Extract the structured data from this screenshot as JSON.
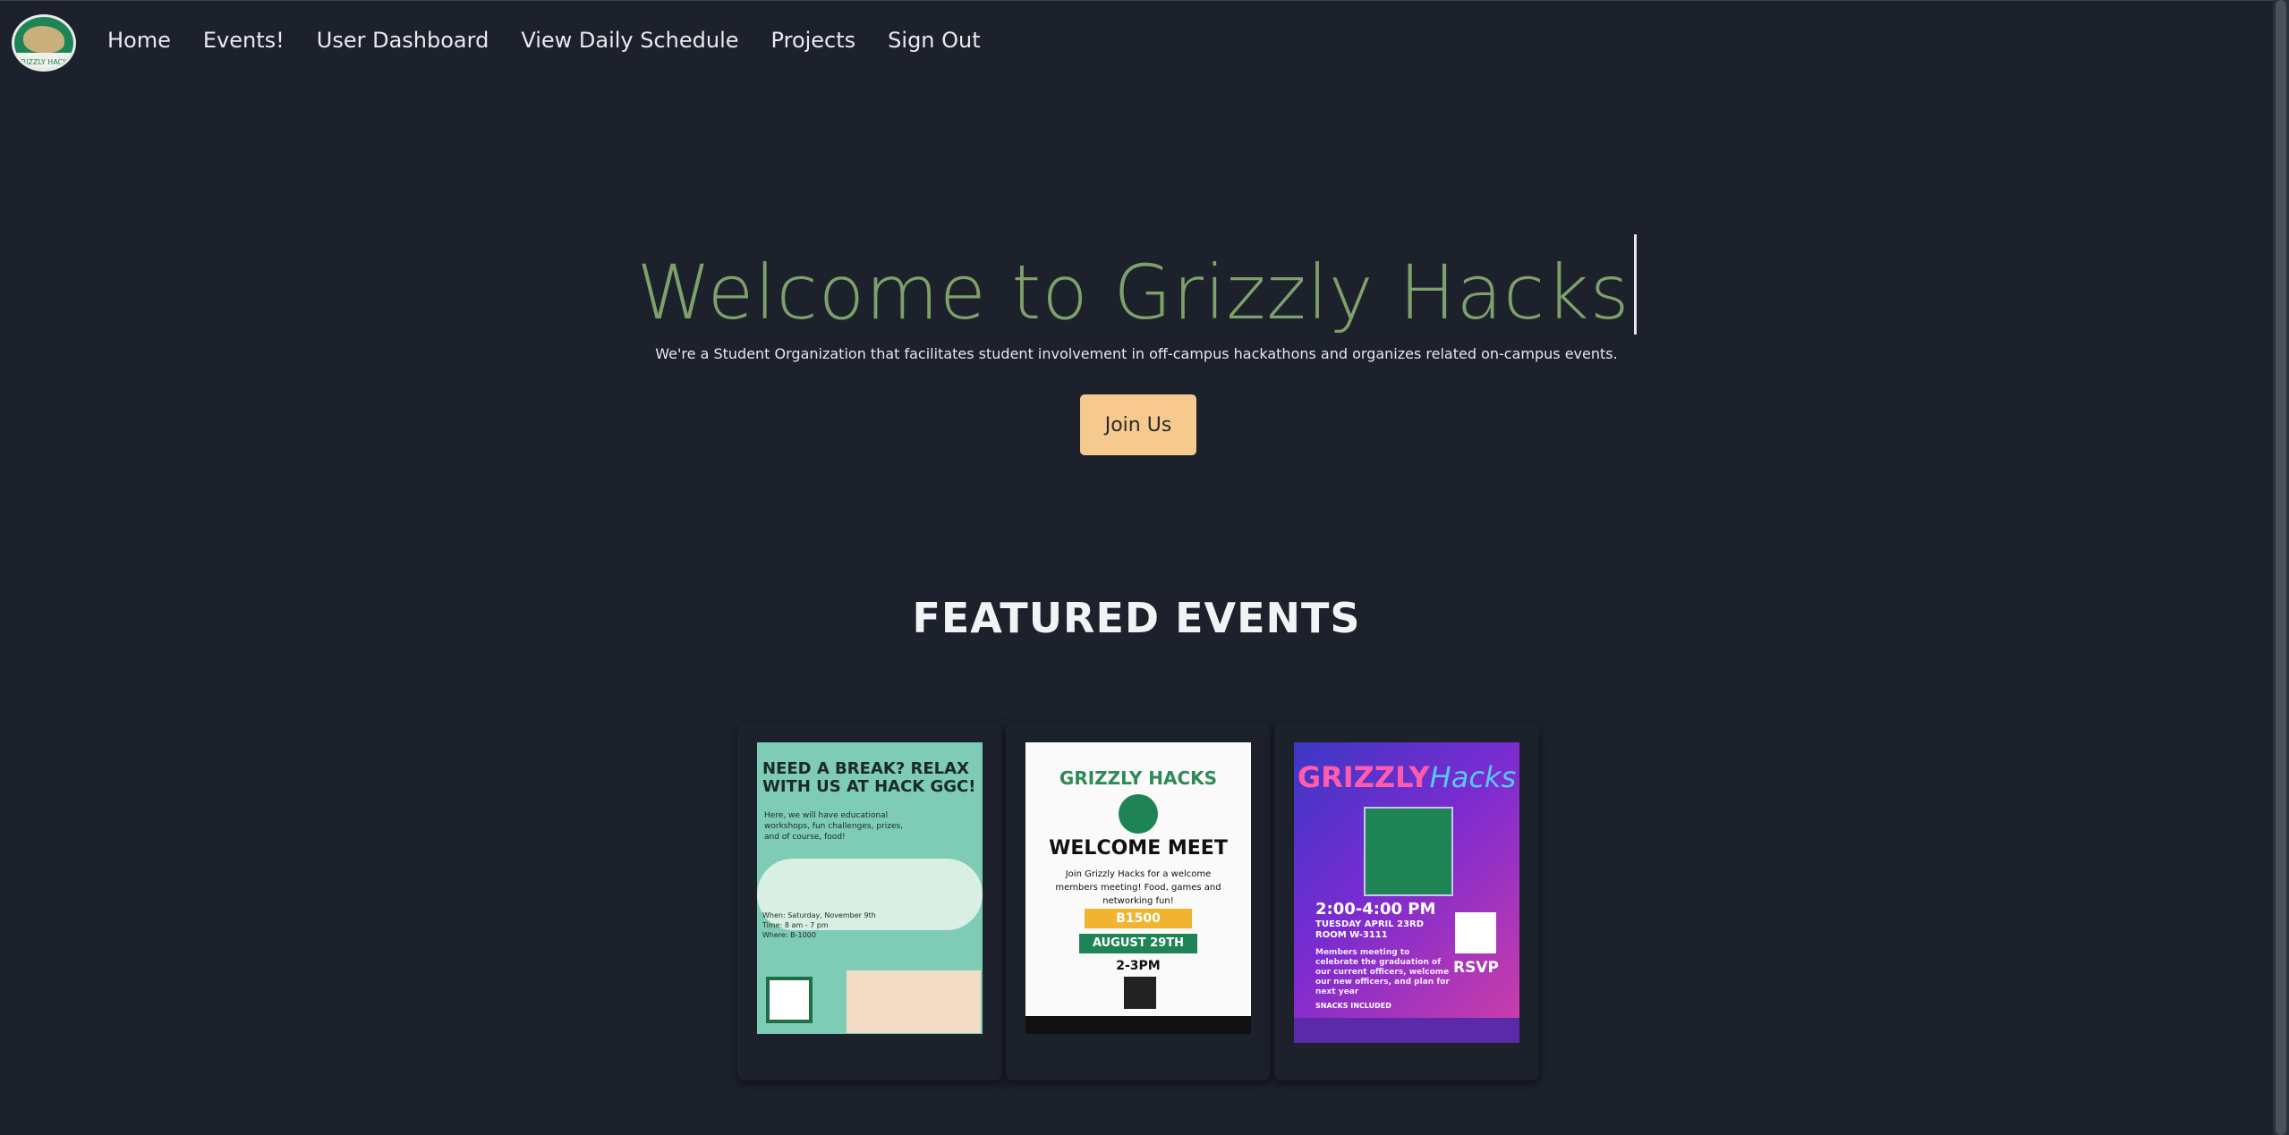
{
  "logo": {
    "text": "GRIZZLY HACKS"
  },
  "nav": {
    "items": [
      "Home",
      "Events!",
      "User Dashboard",
      "View Daily Schedule",
      "Projects",
      "Sign Out"
    ]
  },
  "hero": {
    "title": "Welcome to Grizzly Hacks",
    "subtitle": "We're a Student Organization that facilitates student involvement in off-campus hackathons and organizes related on-campus events.",
    "button": "Join Us"
  },
  "featured": {
    "heading": "FEATURED EVENTS",
    "posters": [
      {
        "headline": "NEED A BREAK? RELAX WITH US AT HACK GGC!",
        "body": "Here, we will have educational workshops, fun challenges, prizes, and of course, food!",
        "when": "When: Saturday, November 9th",
        "time": "Time: 8 am - 7 pm",
        "where": "Where: B-1000"
      },
      {
        "title": "GRIZZLY HACKS",
        "headline": "WELCOME MEET",
        "body": "Join Grizzly Hacks for a welcome members meeting! Food, games and networking fun!",
        "room": "B1500",
        "date": "AUGUST 29TH",
        "time": "2-3PM"
      },
      {
        "title_a": "GRIZZLY",
        "title_b": "Hacks",
        "time": "2:00-4:00 PM",
        "date": "TUESDAY APRIL 23RD",
        "room": "ROOM W-3111",
        "body": "Members meeting to celebrate the graduation of our current officers, welcome our new officers, and plan for next year",
        "rsvp": "RSVP",
        "snacks": "SNACKS INCLUDED"
      }
    ]
  },
  "colors": {
    "background": "#1c212c",
    "title_green": "#7ea06a",
    "button_bg": "#f6c98e"
  }
}
